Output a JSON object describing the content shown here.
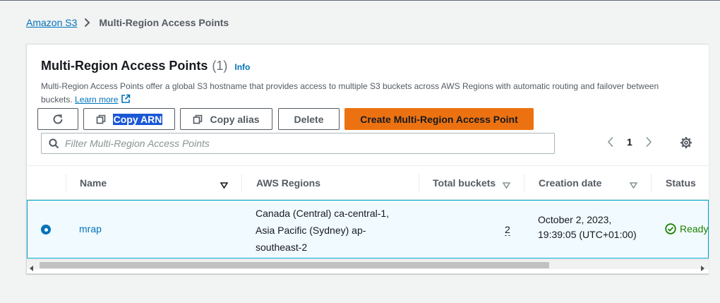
{
  "breadcrumb": {
    "root": "Amazon S3",
    "current": "Multi-Region Access Points"
  },
  "panel": {
    "title": "Multi-Region Access Points",
    "count": "(1)",
    "info": "Info",
    "description": "Multi-Region Access Points offer a global S3 hostname that provides access to multiple S3 buckets across AWS Regions with automatic routing and failover between buckets.",
    "learn_more": "Learn more"
  },
  "toolbar": {
    "copy_arn": "Copy ARN",
    "copy_alias": "Copy alias",
    "delete": "Delete",
    "create": "Create Multi-Region Access Point"
  },
  "filter": {
    "placeholder": "Filter Multi-Region Access Points"
  },
  "pagination": {
    "page": "1"
  },
  "table": {
    "columns": [
      "Name",
      "AWS Regions",
      "Total buckets",
      "Creation date",
      "Status"
    ],
    "rows": [
      {
        "name": "mrap",
        "regions_line1": "Canada (Central) ca-central-1,",
        "regions_line2": "Asia Pacific (Sydney) ap-",
        "regions_line3": "southeast-2",
        "total_buckets": "2",
        "creation_line1": "October 2, 2023,",
        "creation_line2": "19:39:05 (UTC+01:00)",
        "status": "Ready",
        "selected": true
      }
    ]
  },
  "colors": {
    "accent": "#0073bb",
    "primary_button": "#ec7211",
    "success": "#1d8102",
    "selection": "#1a57d6"
  }
}
